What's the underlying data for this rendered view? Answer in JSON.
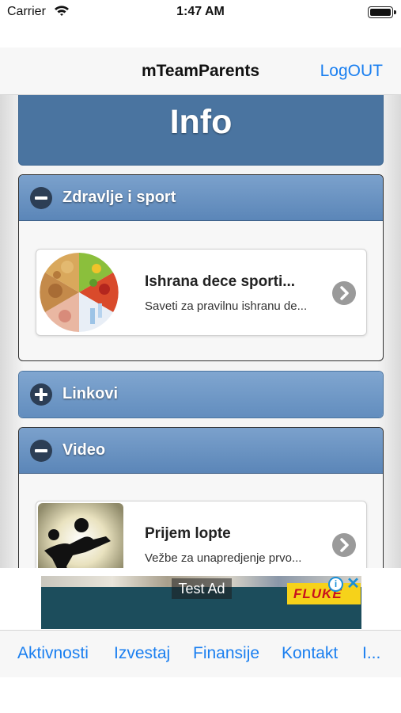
{
  "status_bar": {
    "carrier": "Carrier",
    "time": "1:47 AM",
    "icons": [
      "wifi-icon",
      "battery-icon"
    ]
  },
  "nav_bar": {
    "title": "mTeamParents",
    "logout": "LogOUT"
  },
  "page": {
    "title": "Info"
  },
  "sections": [
    {
      "label": "Zdravlje i sport",
      "expanded": true,
      "icon": "minus-circle-icon",
      "items": [
        {
          "title": "Ishrana dece sportista",
          "title_display": "Ishrana dece sporti...",
          "subtitle": "Saveti za pravilnu ishranu de...",
          "image": "food-wheel-image",
          "chevron": "chevron-right-icon"
        }
      ]
    },
    {
      "label": "Linkovi",
      "expanded": false,
      "icon": "plus-circle-icon",
      "items": []
    },
    {
      "label": "Video",
      "expanded": true,
      "icon": "minus-circle-icon",
      "items": [
        {
          "title": "Prijem lopte",
          "subtitle": "Vežbe za unapredjenje prvo...",
          "image": "soccer-player-silhouette-image",
          "chevron": "chevron-right-icon"
        }
      ]
    }
  ],
  "ad": {
    "label": "Test Ad",
    "brand": "FLUKE",
    "info_icon": "info-icon",
    "close_icon": "close-icon"
  },
  "tab_bar": {
    "items": [
      "Aktivnosti",
      "Izvestaj",
      "Finansije",
      "Kontakt",
      "I..."
    ]
  },
  "colors": {
    "accent": "#1a7ff0",
    "header_blue": "#4a74a0",
    "section_blue": "#6d95c4"
  }
}
